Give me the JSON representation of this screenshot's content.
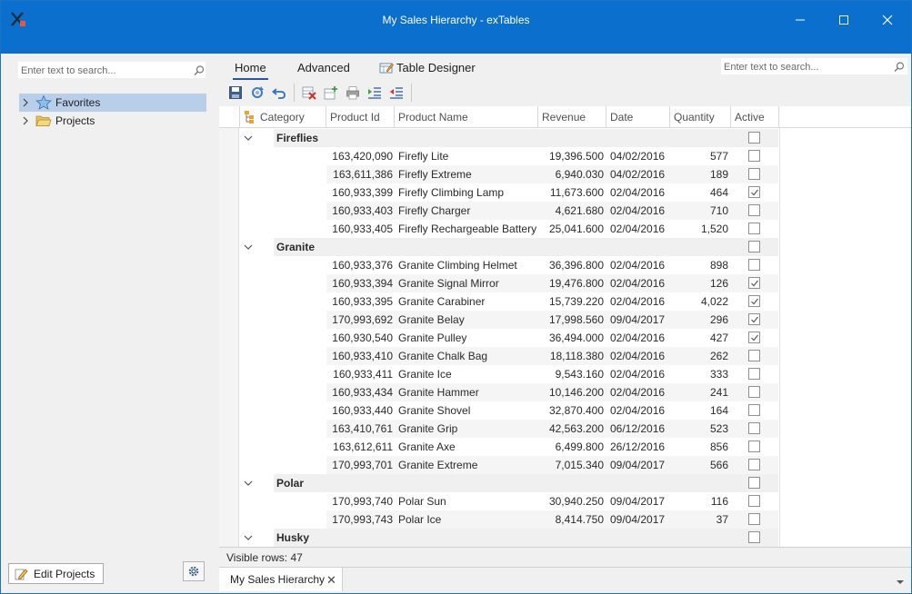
{
  "window": {
    "title": "My Sales Hierarchy - exTables"
  },
  "left_panel": {
    "search_placeholder": "Enter text to search...",
    "tree": [
      {
        "label": "Favorites",
        "icon": "star-icon",
        "selected": true
      },
      {
        "label": "Projects",
        "icon": "folder-icon",
        "selected": false
      }
    ],
    "edit_projects_label": "Edit Projects"
  },
  "ribbon": {
    "tabs": [
      {
        "label": "Home",
        "active": true
      },
      {
        "label": "Advanced",
        "active": false
      },
      {
        "label": "Table Designer",
        "active": false
      }
    ],
    "search_placeholder": "Enter text to search..."
  },
  "grid": {
    "columns": [
      "Category",
      "Product Id",
      "Product Name",
      "Revenue",
      "Date",
      "Quantity",
      "Active"
    ],
    "groups": [
      {
        "name": "Fireflies",
        "rows": [
          {
            "pid": "163,420,090",
            "name": "Firefly Lite",
            "rev": "19,396.500",
            "date": "04/02/2016",
            "qty": "577",
            "active": false
          },
          {
            "pid": "163,611,386",
            "name": "Firefly Extreme",
            "rev": "6,940.030",
            "date": "04/02/2016",
            "qty": "189",
            "active": false
          },
          {
            "pid": "160,933,399",
            "name": "Firefly Climbing Lamp",
            "rev": "11,673.600",
            "date": "02/04/2016",
            "qty": "464",
            "active": true
          },
          {
            "pid": "160,933,403",
            "name": "Firefly Charger",
            "rev": "4,621.680",
            "date": "02/04/2016",
            "qty": "710",
            "active": false
          },
          {
            "pid": "160,933,405",
            "name": "Firefly Rechargeable Battery",
            "rev": "25,041.600",
            "date": "02/04/2016",
            "qty": "1,520",
            "active": false
          }
        ]
      },
      {
        "name": "Granite",
        "rows": [
          {
            "pid": "160,933,376",
            "name": "Granite Climbing Helmet",
            "rev": "36,396.800",
            "date": "02/04/2016",
            "qty": "898",
            "active": false
          },
          {
            "pid": "160,933,394",
            "name": "Granite Signal Mirror",
            "rev": "19,476.800",
            "date": "02/04/2016",
            "qty": "126",
            "active": true
          },
          {
            "pid": "160,933,395",
            "name": "Granite Carabiner",
            "rev": "15,739.220",
            "date": "02/04/2016",
            "qty": "4,022",
            "active": true
          },
          {
            "pid": "170,993,692",
            "name": "Granite Belay",
            "rev": "17,998.560",
            "date": "09/04/2017",
            "qty": "296",
            "active": true
          },
          {
            "pid": "160,930,540",
            "name": "Granite Pulley",
            "rev": "36,494.000",
            "date": "02/04/2016",
            "qty": "427",
            "active": true
          },
          {
            "pid": "160,933,410",
            "name": "Granite Chalk Bag",
            "rev": "18,118.380",
            "date": "02/04/2016",
            "qty": "262",
            "active": false
          },
          {
            "pid": "160,933,411",
            "name": "Granite Ice",
            "rev": "9,543.160",
            "date": "02/04/2016",
            "qty": "333",
            "active": false
          },
          {
            "pid": "160,933,434",
            "name": "Granite Hammer",
            "rev": "10,146.200",
            "date": "02/04/2016",
            "qty": "241",
            "active": false
          },
          {
            "pid": "160,933,440",
            "name": "Granite Shovel",
            "rev": "32,870.400",
            "date": "02/04/2016",
            "qty": "164",
            "active": false
          },
          {
            "pid": "163,410,761",
            "name": "Granite Grip",
            "rev": "42,563.200",
            "date": "06/12/2016",
            "qty": "523",
            "active": false
          },
          {
            "pid": "163,612,611",
            "name": "Granite Axe",
            "rev": "6,499.800",
            "date": "26/12/2016",
            "qty": "856",
            "active": false
          },
          {
            "pid": "170,993,701",
            "name": "Granite Extreme",
            "rev": "7,015.340",
            "date": "09/04/2017",
            "qty": "566",
            "active": false
          }
        ]
      },
      {
        "name": "Polar",
        "rows": [
          {
            "pid": "170,993,740",
            "name": "Polar Sun",
            "rev": "30,940.250",
            "date": "09/04/2017",
            "qty": "116",
            "active": false
          },
          {
            "pid": "170,993,743",
            "name": "Polar Ice",
            "rev": "8,414.750",
            "date": "09/04/2017",
            "qty": "37",
            "active": false
          }
        ]
      },
      {
        "name": "Husky",
        "rows": []
      }
    ]
  },
  "status": {
    "visible_rows": "Visible rows: 47"
  },
  "doc_tabs": [
    {
      "label": "My Sales Hierarchy"
    }
  ],
  "colors": {
    "titlebar": "#0b6fce",
    "selection": "#b9cfe9",
    "tab_underline": "#2b579a"
  }
}
